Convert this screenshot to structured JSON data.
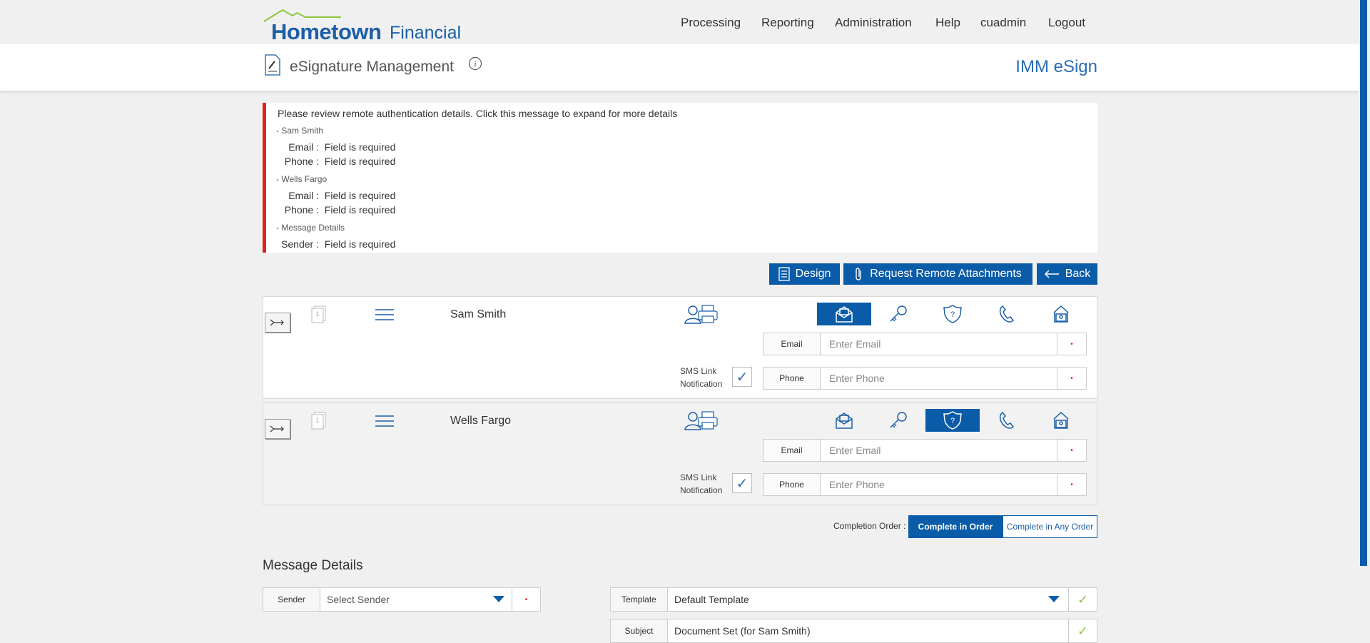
{
  "brand": {
    "main": "Hometown",
    "sub": "Financial"
  },
  "nav": [
    "Processing",
    "Reporting",
    "Administration",
    "Help",
    "cuadmin",
    "Logout"
  ],
  "header": {
    "title": "eSignature Management",
    "product": "IMM eSign"
  },
  "errors": {
    "headline": "Please review remote authentication details. Click this message to expand for more details",
    "groups": [
      {
        "name": "- Sam Smith",
        "items": [
          {
            "label": "Email :",
            "msg": "Field is required"
          },
          {
            "label": "Phone :",
            "msg": "Field is required"
          }
        ]
      },
      {
        "name": "- Wells Fargo",
        "items": [
          {
            "label": "Email :",
            "msg": "Field is required"
          },
          {
            "label": "Phone :",
            "msg": "Field is required"
          }
        ]
      },
      {
        "name": "- Message Details",
        "items": [
          {
            "label": "Sender :",
            "msg": "Field is required"
          }
        ]
      }
    ]
  },
  "actions": {
    "design": "Design",
    "attachments": "Request Remote Attachments",
    "back": "Back"
  },
  "recipients": [
    {
      "name": "Sam Smith",
      "active_auth": "email-auth",
      "sms_label_1": "SMS Link",
      "sms_label_2": "Notification",
      "email_label": "Email",
      "email_placeholder": "Enter Email",
      "phone_label": "Phone",
      "phone_placeholder": "Enter Phone",
      "required_mark": "•"
    },
    {
      "name": "Wells Fargo",
      "active_auth": "question-auth",
      "sms_label_1": "SMS Link",
      "sms_label_2": "Notification",
      "email_label": "Email",
      "email_placeholder": "Enter Email",
      "phone_label": "Phone",
      "phone_placeholder": "Enter Phone",
      "required_mark": "•"
    }
  ],
  "auth_icons": [
    "person-icon",
    "email-auth-icon",
    "key-icon",
    "question-shield-icon",
    "phone-icon",
    "id-card-icon"
  ],
  "completion": {
    "label": "Completion Order :",
    "in_order": "Complete in Order",
    "any_order": "Complete in Any Order",
    "selected": "in_order"
  },
  "message_details": {
    "title": "Message Details",
    "sender_label": "Sender",
    "sender_value": "Select Sender",
    "template_label": "Template",
    "template_value": "Default Template",
    "subject_label": "Subject",
    "subject_value": "Document Set (for Sam Smith)",
    "required_mark": "•",
    "ok_mark": "✓"
  },
  "colors": {
    "accent": "#0b5ca8",
    "error": "#e02020",
    "brand_green": "#8dc63f"
  }
}
